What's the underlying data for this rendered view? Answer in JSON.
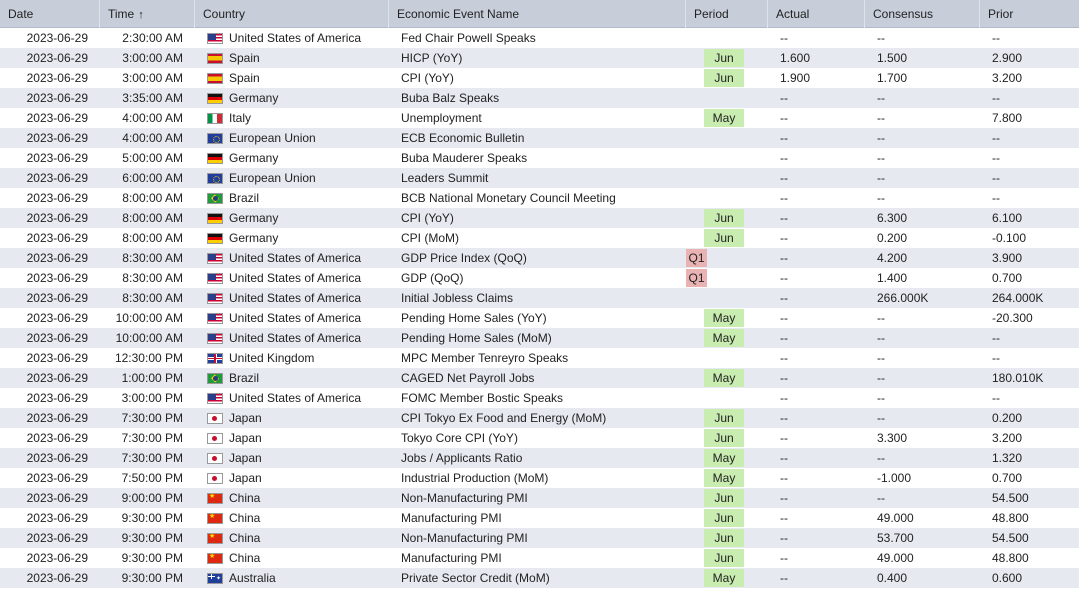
{
  "colors": {
    "header_bg": "#c7cdd9",
    "row_alt": "#e6e9ef",
    "period_green": "#c9ecb1",
    "period_red": "#eab3b3"
  },
  "columns": {
    "date": "Date",
    "time": "Time",
    "time_sort_icon": "arrow-up-icon",
    "country": "Country",
    "event": "Economic Event Name",
    "period": "Period",
    "actual": "Actual",
    "consensus": "Consensus",
    "prior": "Prior"
  },
  "rows": [
    {
      "date": "2023-06-29",
      "time": "2:30:00 AM",
      "flag": "us",
      "country": "United States of America",
      "event": "Fed Chair Powell Speaks",
      "period": "",
      "period_color": "",
      "actual": "--",
      "consensus": "--",
      "prior": "--"
    },
    {
      "date": "2023-06-29",
      "time": "3:00:00 AM",
      "flag": "es",
      "country": "Spain",
      "event": "HICP (YoY)",
      "period": "Jun",
      "period_color": "green",
      "actual": "1.600",
      "consensus": "1.500",
      "prior": "2.900"
    },
    {
      "date": "2023-06-29",
      "time": "3:00:00 AM",
      "flag": "es",
      "country": "Spain",
      "event": "CPI (YoY)",
      "period": "Jun",
      "period_color": "green",
      "actual": "1.900",
      "consensus": "1.700",
      "prior": "3.200"
    },
    {
      "date": "2023-06-29",
      "time": "3:35:00 AM",
      "flag": "de",
      "country": "Germany",
      "event": "Buba Balz Speaks",
      "period": "",
      "period_color": "",
      "actual": "--",
      "consensus": "--",
      "prior": "--"
    },
    {
      "date": "2023-06-29",
      "time": "4:00:00 AM",
      "flag": "it",
      "country": "Italy",
      "event": "Unemployment",
      "period": "May",
      "period_color": "green",
      "actual": "--",
      "consensus": "--",
      "prior": "7.800"
    },
    {
      "date": "2023-06-29",
      "time": "4:00:00 AM",
      "flag": "eu",
      "country": "European Union",
      "event": "ECB Economic Bulletin",
      "period": "",
      "period_color": "",
      "actual": "--",
      "consensus": "--",
      "prior": "--"
    },
    {
      "date": "2023-06-29",
      "time": "5:00:00 AM",
      "flag": "de",
      "country": "Germany",
      "event": "Buba Mauderer Speaks",
      "period": "",
      "period_color": "",
      "actual": "--",
      "consensus": "--",
      "prior": "--"
    },
    {
      "date": "2023-06-29",
      "time": "6:00:00 AM",
      "flag": "eu",
      "country": "European Union",
      "event": "Leaders Summit",
      "period": "",
      "period_color": "",
      "actual": "--",
      "consensus": "--",
      "prior": "--"
    },
    {
      "date": "2023-06-29",
      "time": "8:00:00 AM",
      "flag": "br",
      "country": "Brazil",
      "event": "BCB National Monetary Council Meeting",
      "period": "",
      "period_color": "",
      "actual": "--",
      "consensus": "--",
      "prior": "--"
    },
    {
      "date": "2023-06-29",
      "time": "8:00:00 AM",
      "flag": "de",
      "country": "Germany",
      "event": "CPI (YoY)",
      "period": "Jun",
      "period_color": "green",
      "actual": "--",
      "consensus": "6.300",
      "prior": "6.100"
    },
    {
      "date": "2023-06-29",
      "time": "8:00:00 AM",
      "flag": "de",
      "country": "Germany",
      "event": "CPI (MoM)",
      "period": "Jun",
      "period_color": "green",
      "actual": "--",
      "consensus": "0.200",
      "prior": "-0.100"
    },
    {
      "date": "2023-06-29",
      "time": "8:30:00 AM",
      "flag": "us",
      "country": "United States of America",
      "event": "GDP Price Index (QoQ)",
      "period": "Q1",
      "period_color": "red",
      "actual": "--",
      "consensus": "4.200",
      "prior": "3.900"
    },
    {
      "date": "2023-06-29",
      "time": "8:30:00 AM",
      "flag": "us",
      "country": "United States of America",
      "event": "GDP (QoQ)",
      "period": "Q1",
      "period_color": "red",
      "actual": "--",
      "consensus": "1.400",
      "prior": "0.700"
    },
    {
      "date": "2023-06-29",
      "time": "8:30:00 AM",
      "flag": "us",
      "country": "United States of America",
      "event": "Initial Jobless Claims",
      "period": "",
      "period_color": "",
      "actual": "--",
      "consensus": "266.000K",
      "prior": "264.000K"
    },
    {
      "date": "2023-06-29",
      "time": "10:00:00 AM",
      "flag": "us",
      "country": "United States of America",
      "event": "Pending Home Sales (YoY)",
      "period": "May",
      "period_color": "green",
      "actual": "--",
      "consensus": "--",
      "prior": "-20.300"
    },
    {
      "date": "2023-06-29",
      "time": "10:00:00 AM",
      "flag": "us",
      "country": "United States of America",
      "event": "Pending Home Sales (MoM)",
      "period": "May",
      "period_color": "green",
      "actual": "--",
      "consensus": "--",
      "prior": "--"
    },
    {
      "date": "2023-06-29",
      "time": "12:30:00 PM",
      "flag": "gb",
      "country": "United Kingdom",
      "event": "MPC Member Tenreyro Speaks",
      "period": "",
      "period_color": "",
      "actual": "--",
      "consensus": "--",
      "prior": "--"
    },
    {
      "date": "2023-06-29",
      "time": "1:00:00 PM",
      "flag": "br",
      "country": "Brazil",
      "event": "CAGED Net Payroll Jobs",
      "period": "May",
      "period_color": "green",
      "actual": "--",
      "consensus": "--",
      "prior": "180.010K"
    },
    {
      "date": "2023-06-29",
      "time": "3:00:00 PM",
      "flag": "us",
      "country": "United States of America",
      "event": "FOMC Member Bostic Speaks",
      "period": "",
      "period_color": "",
      "actual": "--",
      "consensus": "--",
      "prior": "--"
    },
    {
      "date": "2023-06-29",
      "time": "7:30:00 PM",
      "flag": "jp",
      "country": "Japan",
      "event": "CPI Tokyo Ex Food and Energy (MoM)",
      "period": "Jun",
      "period_color": "green",
      "actual": "--",
      "consensus": "--",
      "prior": "0.200"
    },
    {
      "date": "2023-06-29",
      "time": "7:30:00 PM",
      "flag": "jp",
      "country": "Japan",
      "event": "Tokyo Core CPI (YoY)",
      "period": "Jun",
      "period_color": "green",
      "actual": "--",
      "consensus": "3.300",
      "prior": "3.200"
    },
    {
      "date": "2023-06-29",
      "time": "7:30:00 PM",
      "flag": "jp",
      "country": "Japan",
      "event": "Jobs / Applicants Ratio",
      "period": "May",
      "period_color": "green",
      "actual": "--",
      "consensus": "--",
      "prior": "1.320"
    },
    {
      "date": "2023-06-29",
      "time": "7:50:00 PM",
      "flag": "jp",
      "country": "Japan",
      "event": "Industrial Production (MoM)",
      "period": "May",
      "period_color": "green",
      "actual": "--",
      "consensus": "-1.000",
      "prior": "0.700"
    },
    {
      "date": "2023-06-29",
      "time": "9:00:00 PM",
      "flag": "cn",
      "country": "China",
      "event": "Non-Manufacturing PMI",
      "period": "Jun",
      "period_color": "green",
      "actual": "--",
      "consensus": "--",
      "prior": "54.500"
    },
    {
      "date": "2023-06-29",
      "time": "9:30:00 PM",
      "flag": "cn",
      "country": "China",
      "event": "Manufacturing PMI",
      "period": "Jun",
      "period_color": "green",
      "actual": "--",
      "consensus": "49.000",
      "prior": "48.800"
    },
    {
      "date": "2023-06-29",
      "time": "9:30:00 PM",
      "flag": "cn",
      "country": "China",
      "event": "Non-Manufacturing PMI",
      "period": "Jun",
      "period_color": "green",
      "actual": "--",
      "consensus": "53.700",
      "prior": "54.500"
    },
    {
      "date": "2023-06-29",
      "time": "9:30:00 PM",
      "flag": "cn",
      "country": "China",
      "event": "Manufacturing PMI",
      "period": "Jun",
      "period_color": "green",
      "actual": "--",
      "consensus": "49.000",
      "prior": "48.800"
    },
    {
      "date": "2023-06-29",
      "time": "9:30:00 PM",
      "flag": "au",
      "country": "Australia",
      "event": "Private Sector Credit (MoM)",
      "period": "May",
      "period_color": "green",
      "actual": "--",
      "consensus": "0.400",
      "prior": "0.600"
    }
  ]
}
